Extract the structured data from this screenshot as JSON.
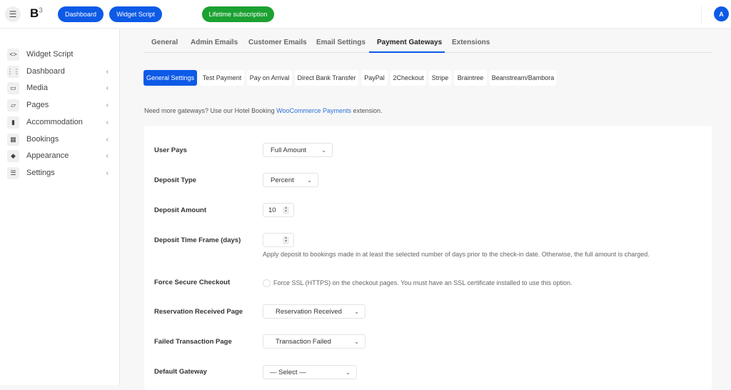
{
  "topbar": {
    "logo_text": "B",
    "logo_sup": "3",
    "buttons": [
      "Dashboard",
      "Widget Script"
    ],
    "subscription_label": "Lifetime subscription",
    "avatar_initial": "A",
    "colors": {
      "primary": "#0d5ae6",
      "success": "#1ba132"
    }
  },
  "sidebar": {
    "items": [
      {
        "label": "Widget Script",
        "icon": "code-icon",
        "has_chevron": false
      },
      {
        "label": "Dashboard",
        "icon": "grid-icon",
        "has_chevron": true
      },
      {
        "label": "Media",
        "icon": "image-icon",
        "has_chevron": true
      },
      {
        "label": "Pages",
        "icon": "folder-icon",
        "has_chevron": true
      },
      {
        "label": "Accommodation",
        "icon": "building-icon",
        "has_chevron": true
      },
      {
        "label": "Bookings",
        "icon": "calendar-icon",
        "has_chevron": true
      },
      {
        "label": "Appearance",
        "icon": "paint-bucket-icon",
        "has_chevron": true
      },
      {
        "label": "Settings",
        "icon": "sliders-icon",
        "has_chevron": true
      }
    ]
  },
  "tabs": [
    "General",
    "Admin Emails",
    "Customer Emails",
    "Email Settings",
    "Payment Gateways",
    "Extensions"
  ],
  "active_tab": "Payment Gateways",
  "subtabs": [
    "General Settings",
    "Test Payment",
    "Pay on Arrival",
    "Direct Bank Transfer",
    "PayPal",
    "2Checkout",
    "Stripe",
    "Braintree",
    "Beanstream/Bambora"
  ],
  "active_subtab": "General Settings",
  "note": {
    "prefix": "Need more gateways? Use our Hotel Booking ",
    "link": "WooCommerce Payments",
    "suffix": " extension."
  },
  "form": {
    "user_pays": {
      "label": "User Pays",
      "value": "Full Amount"
    },
    "deposit_type": {
      "label": "Deposit Type",
      "value": "Percent"
    },
    "deposit_amount": {
      "label": "Deposit Amount",
      "value": "10"
    },
    "deposit_time_frame": {
      "label": "Deposit Time Frame (days)",
      "value": "",
      "help": "Apply deposit to bookings made in at least the selected number of days prior to the check-in date. Otherwise, the full amount is charged."
    },
    "force_secure": {
      "label": "Force Secure Checkout",
      "checked": false,
      "text": "Force SSL (HTTPS) on the checkout pages. You must have an SSL certificate installed to use this option."
    },
    "reservation_page": {
      "label": "Reservation Received Page",
      "value": "Reservation Received"
    },
    "failed_page": {
      "label": "Failed Transaction Page",
      "value": "Transaction Failed"
    },
    "default_gateway": {
      "label": "Default Gateway",
      "value": "— Select —"
    }
  }
}
